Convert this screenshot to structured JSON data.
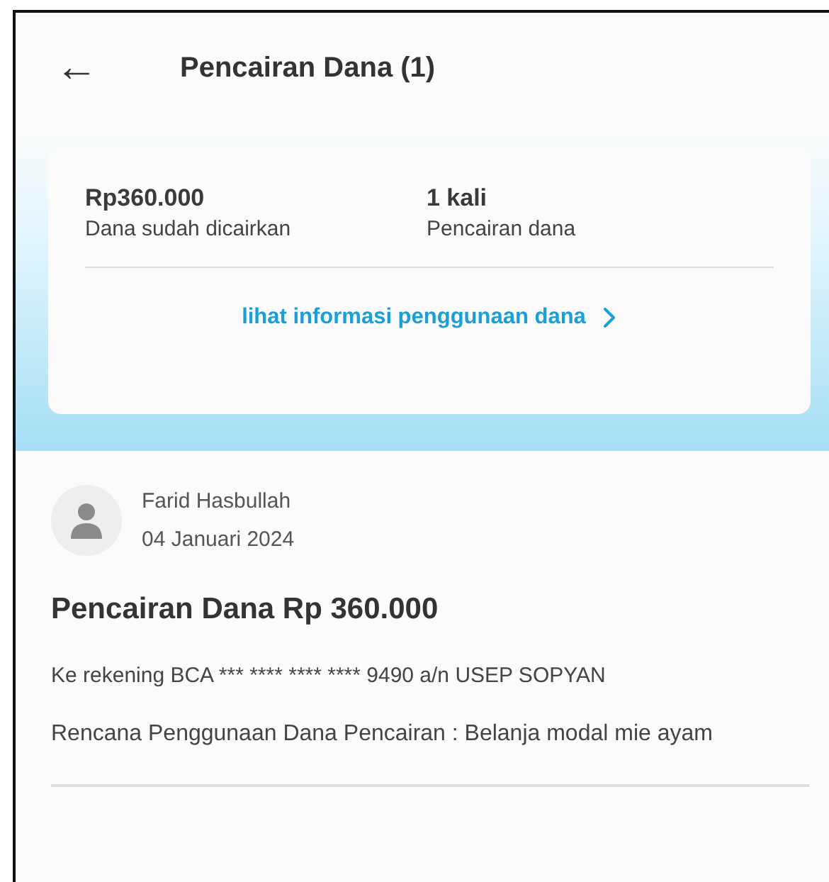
{
  "header": {
    "back_icon": "←",
    "title": "Pencairan Dana (1)"
  },
  "summary": {
    "stats": [
      {
        "value": "Rp360.000",
        "label": "Dana sudah dicairkan"
      },
      {
        "value": "1 kali",
        "label": "Pencairan dana"
      }
    ],
    "link": "lihat informasi penggunaan dana"
  },
  "entry": {
    "name": "Farid Hasbullah",
    "date": "04 Januari 2024",
    "heading": "Pencairan Dana Rp 360.000",
    "account": "Ke rekening BCA *** **** **** **** 9490 a/n USEP SOPYAN",
    "plan": "Rencana Penggunaan Dana Pencairan : Belanja modal mie ayam"
  }
}
